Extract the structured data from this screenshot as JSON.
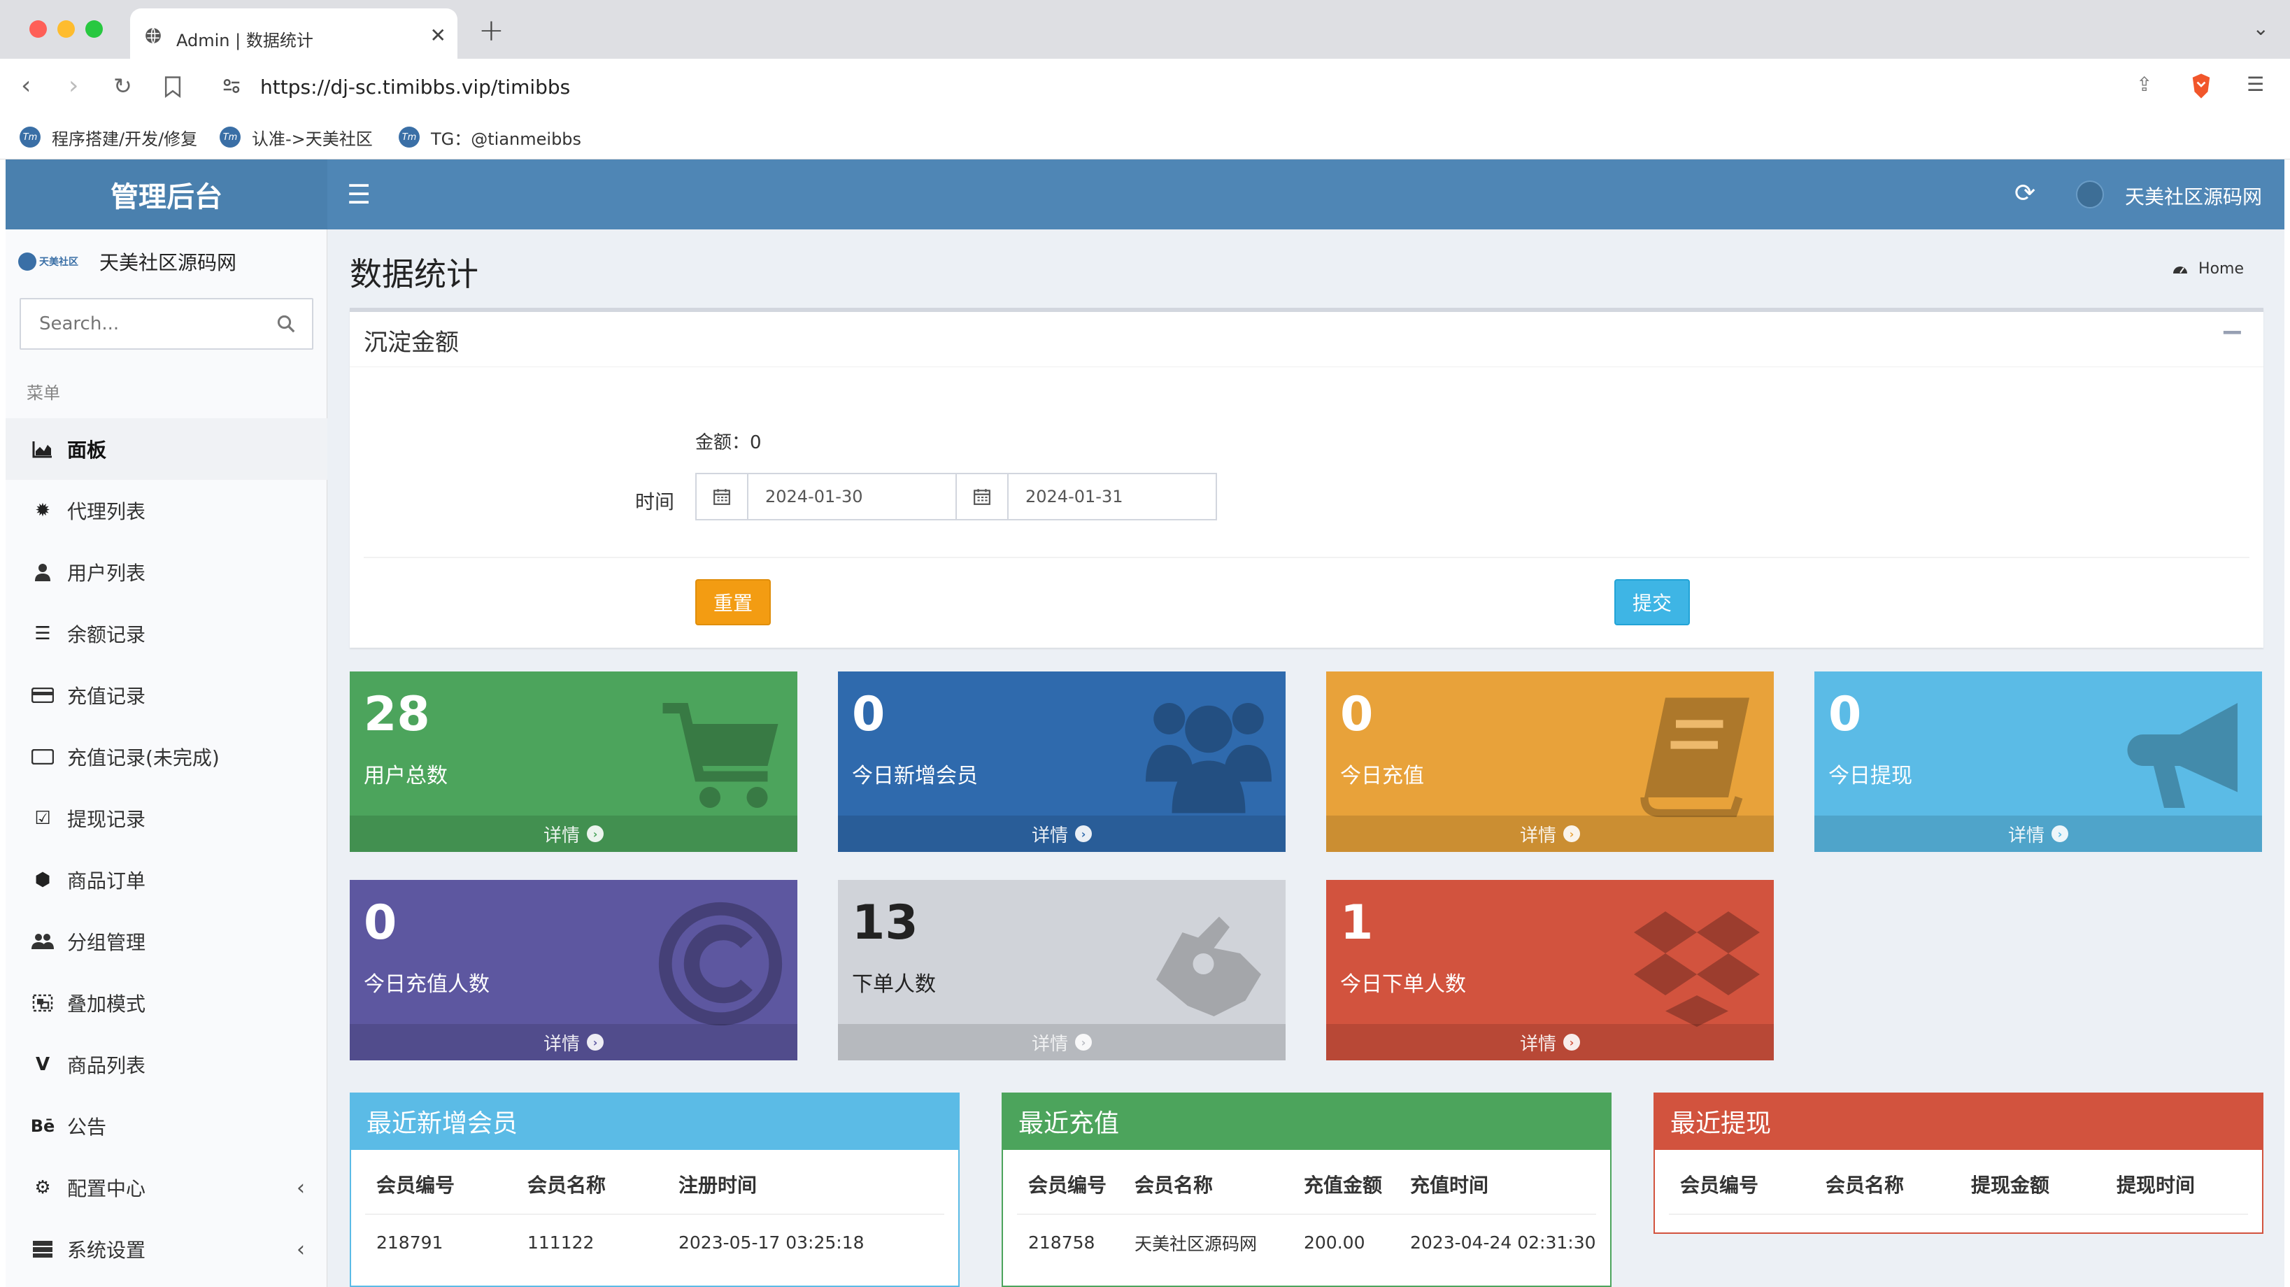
{
  "browser": {
    "tab_title": "Admin | 数据统计",
    "url": "https://dj-sc.timibbs.vip/timibbs",
    "bookmarks": [
      "程序搭建/开发/修复",
      "认准->天美社区",
      "TG：@tianmeibbs"
    ]
  },
  "header": {
    "logo_text": "管理后台",
    "user_name": "天美社区源码网"
  },
  "sidebar": {
    "logo_text": "天美社区",
    "username": "天美社区源码网",
    "search_placeholder": "Search...",
    "menu_header": "菜单",
    "items": [
      {
        "label": "面板",
        "icon": "area-chart-icon",
        "active": true
      },
      {
        "label": "代理列表",
        "icon": "gear-icon"
      },
      {
        "label": "用户列表",
        "icon": "user-icon"
      },
      {
        "label": "余额记录",
        "icon": "list-icon"
      },
      {
        "label": "充值记录",
        "icon": "credit-card-icon"
      },
      {
        "label": "充值记录(未完成)",
        "icon": "card-outline-icon"
      },
      {
        "label": "提现记录",
        "icon": "check-square-icon"
      },
      {
        "label": "商品订单",
        "icon": "cube-icon"
      },
      {
        "label": "分组管理",
        "icon": "users-icon"
      },
      {
        "label": "叠加模式",
        "icon": "object-group-icon"
      },
      {
        "label": "商品列表",
        "icon": "vine-icon"
      },
      {
        "label": "公告",
        "icon": "behance-icon"
      },
      {
        "label": "配置中心",
        "icon": "settings-icon",
        "has_children": true
      },
      {
        "label": "系统设置",
        "icon": "server-icon",
        "has_children": true
      }
    ]
  },
  "content": {
    "title": "数据统计",
    "breadcrumb": "Home"
  },
  "deposit_box": {
    "title": "沉淀金额",
    "amount_label": "金额：0",
    "time_label": "时间",
    "date_from": "2024-01-30",
    "date_to": "2024-01-31",
    "reset_label": "重置",
    "submit_label": "提交"
  },
  "stats": [
    {
      "value": "28",
      "label": "用户总数",
      "footer": "详情",
      "color": "#4ca45c",
      "icon": "shopping-cart-icon"
    },
    {
      "value": "0",
      "label": "今日新增会员",
      "footer": "详情",
      "color": "#2f6aad",
      "icon": "users-icon"
    },
    {
      "value": "0",
      "label": "今日充值",
      "footer": "详情",
      "color": "#e8a23a",
      "icon": "book-icon"
    },
    {
      "value": "0",
      "label": "今日提现",
      "footer": "详情",
      "color": "#5bbbe6",
      "icon": "bullhorn-icon"
    },
    {
      "value": "0",
      "label": "今日充值人数",
      "footer": "详情",
      "color": "#5d57a0",
      "icon": "copyright-icon"
    },
    {
      "value": "13",
      "label": "下单人数",
      "footer": "详情",
      "color": "#d0d3d9",
      "icon": "sign-language-icon"
    },
    {
      "value": "1",
      "label": "今日下单人数",
      "footer": "详情",
      "color": "#d2533e",
      "icon": "dropbox-icon"
    }
  ],
  "panels": {
    "members": {
      "title": "最近新增会员",
      "color": "#5bbbe6",
      "columns": [
        "会员编号",
        "会员名称",
        "注册时间"
      ],
      "rows": [
        [
          "218791",
          "111122",
          "2023-05-17 03:25:18"
        ]
      ]
    },
    "recharge": {
      "title": "最近充值",
      "color": "#4ca45c",
      "columns": [
        "会员编号",
        "会员名称",
        "充值金额",
        "充值时间"
      ],
      "rows": [
        [
          "218758",
          "天美社区源码网",
          "200.00",
          "2023-04-24 02:31:30"
        ]
      ]
    },
    "withdraw": {
      "title": "最近提现",
      "color": "#d2533e",
      "columns": [
        "会员编号",
        "会员名称",
        "提现金额",
        "提现时间"
      ],
      "rows": []
    }
  }
}
